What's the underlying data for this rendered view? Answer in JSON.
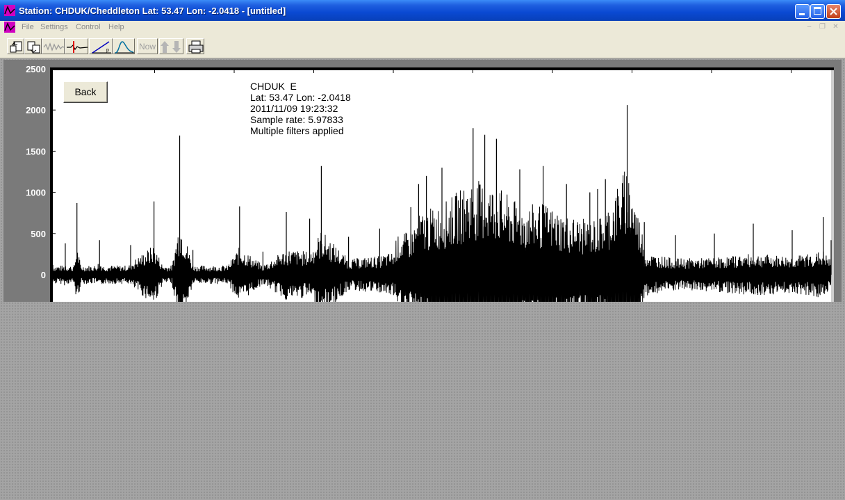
{
  "window": {
    "title": "Station: CHDUK/Cheddleton Lat: 53.47 Lon: -2.0418 - [untitled]",
    "buttons": [
      "minimize",
      "maximize",
      "close"
    ]
  },
  "menu": {
    "items": [
      "File",
      "Settings",
      "Control",
      "Help"
    ]
  },
  "toolbar": {
    "now_label": "Now",
    "icons": [
      "open-icon",
      "save-icon",
      "waveform-icon",
      "pick-icon",
      "ramp-icon",
      "spectrum-icon",
      "now-button",
      "up-down-icon",
      "print-icon"
    ]
  },
  "plot": {
    "back_label": "Back",
    "info": {
      "station": "CHDUK  E",
      "location": "Lat: 53.47 Lon: -2.0418",
      "datetime": "2011/11/09 19:23:32",
      "sample_rate": "Sample rate: 5.97833",
      "filters": "Multiple filters applied"
    },
    "y_ticks": [
      "2500",
      "2000",
      "1500",
      "1000",
      "500",
      "0"
    ]
  },
  "chart_data": {
    "type": "line",
    "title": "",
    "xlabel": "",
    "ylabel": "",
    "ylim": [
      -300,
      2500
    ],
    "x_range": [
      0,
      1
    ],
    "series": [
      {
        "values": [
          [
            0.0,
            120
          ],
          [
            0.008,
            -150
          ],
          [
            0.016,
            380
          ],
          [
            0.024,
            -220
          ],
          [
            0.031,
            870
          ],
          [
            0.04,
            -180
          ],
          [
            0.06,
            420
          ],
          [
            0.08,
            -200
          ],
          [
            0.1,
            360
          ],
          [
            0.13,
            890
          ],
          [
            0.15,
            -210
          ],
          [
            0.163,
            1690
          ],
          [
            0.18,
            300
          ],
          [
            0.21,
            -240
          ],
          [
            0.24,
            830
          ],
          [
            0.27,
            280
          ],
          [
            0.3,
            760
          ],
          [
            0.33,
            680
          ],
          [
            0.345,
            1320
          ],
          [
            0.38,
            460
          ],
          [
            0.42,
            560
          ],
          [
            0.46,
            820
          ],
          [
            0.47,
            1100
          ],
          [
            0.48,
            1200
          ],
          [
            0.5,
            1300
          ],
          [
            0.54,
            1780
          ],
          [
            0.555,
            1700
          ],
          [
            0.57,
            1650
          ],
          [
            0.6,
            1280
          ],
          [
            0.63,
            1320
          ],
          [
            0.66,
            1100
          ],
          [
            0.69,
            1000
          ],
          [
            0.7,
            1040
          ],
          [
            0.71,
            1160
          ],
          [
            0.738,
            2060
          ],
          [
            0.76,
            640
          ],
          [
            0.8,
            480
          ],
          [
            0.85,
            500
          ],
          [
            0.9,
            620
          ],
          [
            0.95,
            540
          ],
          [
            0.99,
            700
          ],
          [
            1.0,
            420
          ]
        ]
      }
    ]
  }
}
